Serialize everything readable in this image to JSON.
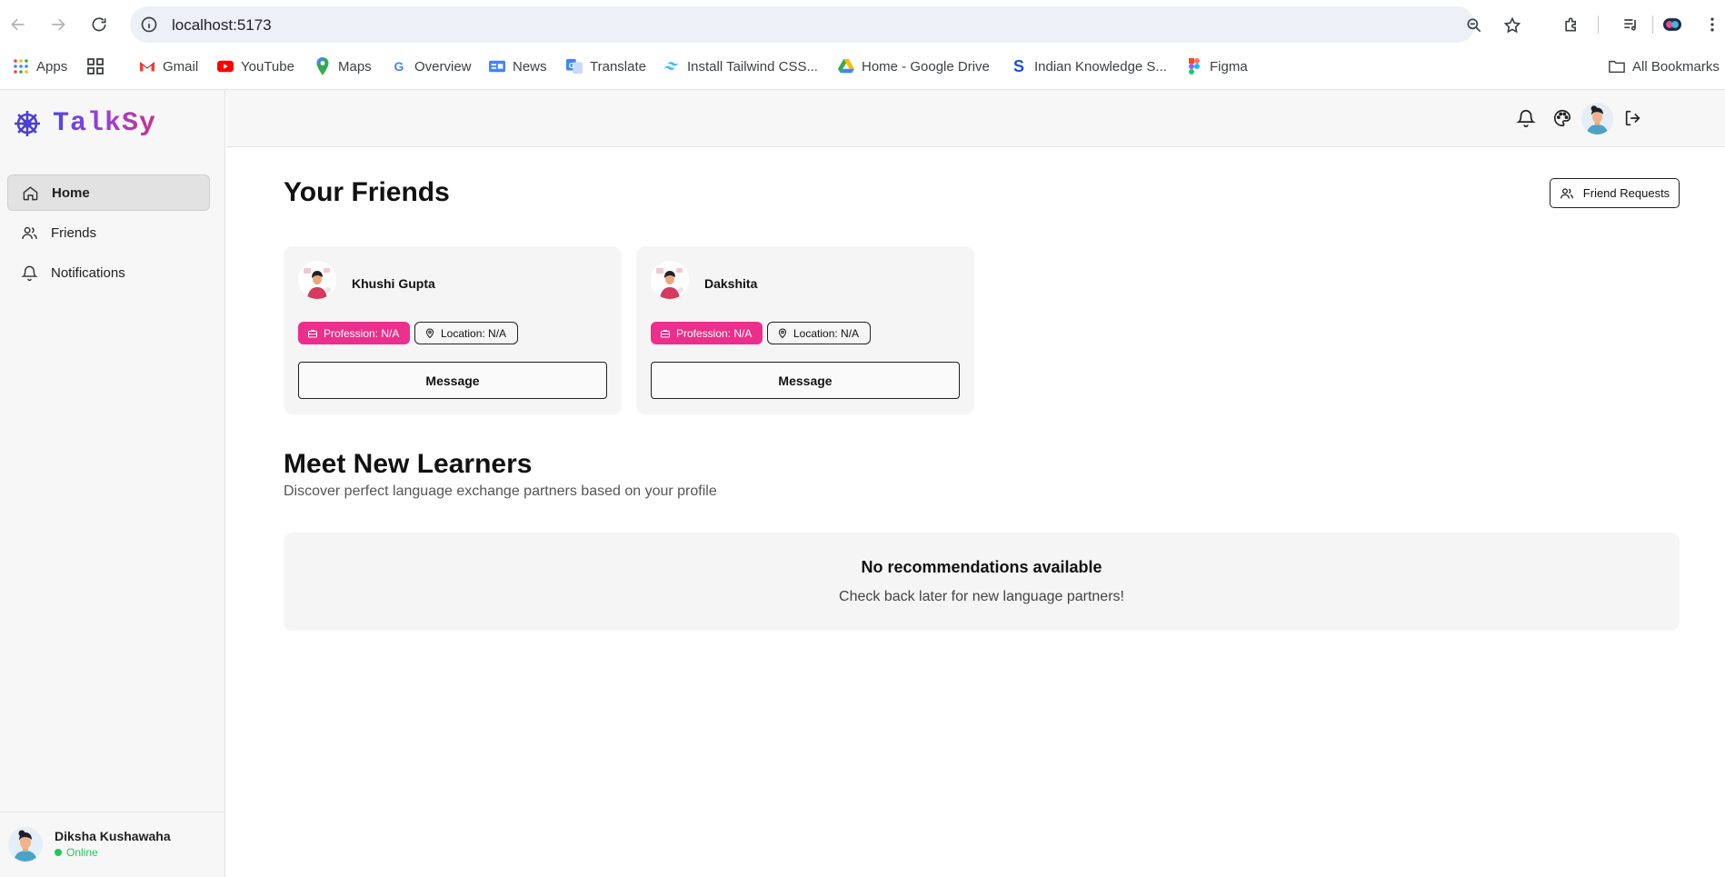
{
  "browser": {
    "url": "localhost:5173",
    "bookmarks": [
      {
        "label": "Apps",
        "icon": "apps-grid-icon"
      },
      {
        "label": "",
        "icon": "tab-groups-icon"
      },
      {
        "label": "Gmail",
        "icon": "gmail-icon"
      },
      {
        "label": "YouTube",
        "icon": "youtube-icon"
      },
      {
        "label": "Maps",
        "icon": "maps-icon"
      },
      {
        "label": "Overview",
        "icon": "google-icon"
      },
      {
        "label": "News",
        "icon": "news-icon"
      },
      {
        "label": "Translate",
        "icon": "translate-icon"
      },
      {
        "label": "Install Tailwind CSS...",
        "icon": "tailwind-icon"
      },
      {
        "label": "Home - Google Drive",
        "icon": "drive-icon"
      },
      {
        "label": "Indian Knowledge S...",
        "icon": "s-icon"
      },
      {
        "label": "Figma",
        "icon": "figma-icon"
      }
    ],
    "all_bookmarks": "All Bookmarks"
  },
  "app": {
    "logo_text": "TalkSy",
    "brand_colors": {
      "primary": "#4f46e5",
      "accent": "#ec2f8c"
    }
  },
  "sidebar": {
    "items": [
      {
        "label": "Home",
        "icon": "home-icon",
        "active": true
      },
      {
        "label": "Friends",
        "icon": "users-icon",
        "active": false
      },
      {
        "label": "Notifications",
        "icon": "bell-icon",
        "active": false
      }
    ],
    "user": {
      "name": "Diksha Kushawaha",
      "status": "Online"
    }
  },
  "main": {
    "title": "Your Friends",
    "friend_requests_label": "Friend Requests",
    "friends": [
      {
        "name": "Khushi Gupta",
        "profession": "Profession: N/A",
        "location": "Location: N/A",
        "action": "Message"
      },
      {
        "name": "Dakshita",
        "profession": "Profession: N/A",
        "location": "Location: N/A",
        "action": "Message"
      }
    ],
    "learners": {
      "title": "Meet New Learners",
      "subtitle": "Discover perfect language exchange partners based on your profile",
      "empty_title": "No recommendations available",
      "empty_subtitle": "Check back later for new language partners!"
    }
  }
}
